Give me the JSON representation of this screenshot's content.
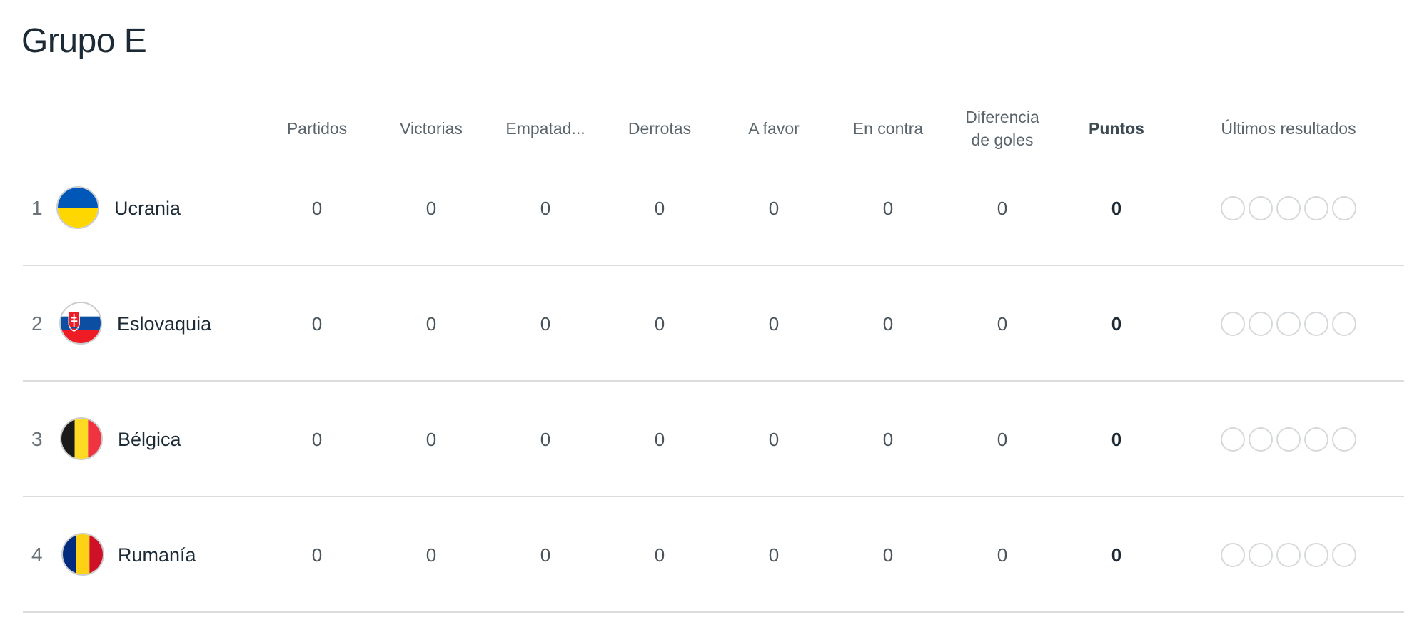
{
  "title": "Grupo E",
  "columns": {
    "played": "Partidos",
    "wins": "Victorias",
    "draws": "Empatad...",
    "losses": "Derrotas",
    "goals_for": "A favor",
    "goals_against": "En contra",
    "goal_diff_line1": "Diferencia",
    "goal_diff_line2": "de goles",
    "points": "Puntos",
    "last_results": "Últimos resultados"
  },
  "rows": [
    {
      "rank": "1",
      "team": "Ucrania",
      "flag_icon": "ukraine-flag-icon",
      "flag_colors": [
        "#0057b7",
        "#ffd700"
      ],
      "played": "0",
      "wins": "0",
      "draws": "0",
      "losses": "0",
      "goals_for": "0",
      "goals_against": "0",
      "goal_diff": "0",
      "points": "0",
      "last_results": [
        "",
        "",
        "",
        "",
        ""
      ]
    },
    {
      "rank": "2",
      "team": "Eslovaquia",
      "flag_icon": "slovakia-flag-icon",
      "flag_colors": [
        "#ffffff",
        "#0b4ea2",
        "#ee1c25"
      ],
      "played": "0",
      "wins": "0",
      "draws": "0",
      "losses": "0",
      "goals_for": "0",
      "goals_against": "0",
      "goal_diff": "0",
      "points": "0",
      "last_results": [
        "",
        "",
        "",
        "",
        ""
      ]
    },
    {
      "rank": "3",
      "team": "Bélgica",
      "flag_icon": "belgium-flag-icon",
      "flag_colors": [
        "#1a1a1a",
        "#fdda24",
        "#ef3340"
      ],
      "played": "0",
      "wins": "0",
      "draws": "0",
      "losses": "0",
      "goals_for": "0",
      "goals_against": "0",
      "goal_diff": "0",
      "points": "0",
      "last_results": [
        "",
        "",
        "",
        "",
        ""
      ]
    },
    {
      "rank": "4",
      "team": "Rumanía",
      "flag_icon": "romania-flag-icon",
      "flag_colors": [
        "#002b7f",
        "#fcd116",
        "#ce1126"
      ],
      "played": "0",
      "wins": "0",
      "draws": "0",
      "losses": "0",
      "goals_for": "0",
      "goals_against": "0",
      "goal_diff": "0",
      "points": "0",
      "last_results": [
        "",
        "",
        "",
        "",
        ""
      ]
    }
  ]
}
